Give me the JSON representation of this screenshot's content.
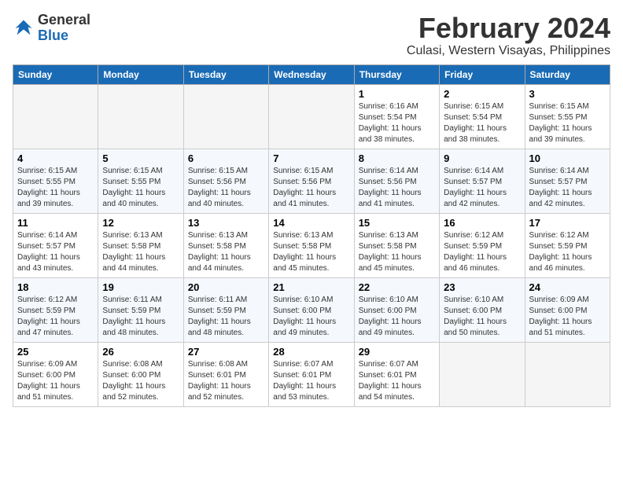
{
  "header": {
    "logo_general": "General",
    "logo_blue": "Blue",
    "month_year": "February 2024",
    "location": "Culasi, Western Visayas, Philippines"
  },
  "days_of_week": [
    "Sunday",
    "Monday",
    "Tuesday",
    "Wednesday",
    "Thursday",
    "Friday",
    "Saturday"
  ],
  "weeks": [
    [
      {
        "day": "",
        "empty": true
      },
      {
        "day": "",
        "empty": true
      },
      {
        "day": "",
        "empty": true
      },
      {
        "day": "",
        "empty": true
      },
      {
        "day": "1",
        "sunrise": "6:16 AM",
        "sunset": "5:54 PM",
        "daylight": "11 hours and 38 minutes."
      },
      {
        "day": "2",
        "sunrise": "6:15 AM",
        "sunset": "5:54 PM",
        "daylight": "11 hours and 38 minutes."
      },
      {
        "day": "3",
        "sunrise": "6:15 AM",
        "sunset": "5:55 PM",
        "daylight": "11 hours and 39 minutes."
      }
    ],
    [
      {
        "day": "4",
        "sunrise": "6:15 AM",
        "sunset": "5:55 PM",
        "daylight": "11 hours and 39 minutes."
      },
      {
        "day": "5",
        "sunrise": "6:15 AM",
        "sunset": "5:55 PM",
        "daylight": "11 hours and 40 minutes."
      },
      {
        "day": "6",
        "sunrise": "6:15 AM",
        "sunset": "5:56 PM",
        "daylight": "11 hours and 40 minutes."
      },
      {
        "day": "7",
        "sunrise": "6:15 AM",
        "sunset": "5:56 PM",
        "daylight": "11 hours and 41 minutes."
      },
      {
        "day": "8",
        "sunrise": "6:14 AM",
        "sunset": "5:56 PM",
        "daylight": "11 hours and 41 minutes."
      },
      {
        "day": "9",
        "sunrise": "6:14 AM",
        "sunset": "5:57 PM",
        "daylight": "11 hours and 42 minutes."
      },
      {
        "day": "10",
        "sunrise": "6:14 AM",
        "sunset": "5:57 PM",
        "daylight": "11 hours and 42 minutes."
      }
    ],
    [
      {
        "day": "11",
        "sunrise": "6:14 AM",
        "sunset": "5:57 PM",
        "daylight": "11 hours and 43 minutes."
      },
      {
        "day": "12",
        "sunrise": "6:13 AM",
        "sunset": "5:58 PM",
        "daylight": "11 hours and 44 minutes."
      },
      {
        "day": "13",
        "sunrise": "6:13 AM",
        "sunset": "5:58 PM",
        "daylight": "11 hours and 44 minutes."
      },
      {
        "day": "14",
        "sunrise": "6:13 AM",
        "sunset": "5:58 PM",
        "daylight": "11 hours and 45 minutes."
      },
      {
        "day": "15",
        "sunrise": "6:13 AM",
        "sunset": "5:58 PM",
        "daylight": "11 hours and 45 minutes."
      },
      {
        "day": "16",
        "sunrise": "6:12 AM",
        "sunset": "5:59 PM",
        "daylight": "11 hours and 46 minutes."
      },
      {
        "day": "17",
        "sunrise": "6:12 AM",
        "sunset": "5:59 PM",
        "daylight": "11 hours and 46 minutes."
      }
    ],
    [
      {
        "day": "18",
        "sunrise": "6:12 AM",
        "sunset": "5:59 PM",
        "daylight": "11 hours and 47 minutes."
      },
      {
        "day": "19",
        "sunrise": "6:11 AM",
        "sunset": "5:59 PM",
        "daylight": "11 hours and 48 minutes."
      },
      {
        "day": "20",
        "sunrise": "6:11 AM",
        "sunset": "5:59 PM",
        "daylight": "11 hours and 48 minutes."
      },
      {
        "day": "21",
        "sunrise": "6:10 AM",
        "sunset": "6:00 PM",
        "daylight": "11 hours and 49 minutes."
      },
      {
        "day": "22",
        "sunrise": "6:10 AM",
        "sunset": "6:00 PM",
        "daylight": "11 hours and 49 minutes."
      },
      {
        "day": "23",
        "sunrise": "6:10 AM",
        "sunset": "6:00 PM",
        "daylight": "11 hours and 50 minutes."
      },
      {
        "day": "24",
        "sunrise": "6:09 AM",
        "sunset": "6:00 PM",
        "daylight": "11 hours and 51 minutes."
      }
    ],
    [
      {
        "day": "25",
        "sunrise": "6:09 AM",
        "sunset": "6:00 PM",
        "daylight": "11 hours and 51 minutes."
      },
      {
        "day": "26",
        "sunrise": "6:08 AM",
        "sunset": "6:00 PM",
        "daylight": "11 hours and 52 minutes."
      },
      {
        "day": "27",
        "sunrise": "6:08 AM",
        "sunset": "6:01 PM",
        "daylight": "11 hours and 52 minutes."
      },
      {
        "day": "28",
        "sunrise": "6:07 AM",
        "sunset": "6:01 PM",
        "daylight": "11 hours and 53 minutes."
      },
      {
        "day": "29",
        "sunrise": "6:07 AM",
        "sunset": "6:01 PM",
        "daylight": "11 hours and 54 minutes."
      },
      {
        "day": "",
        "empty": true
      },
      {
        "day": "",
        "empty": true
      }
    ]
  ]
}
